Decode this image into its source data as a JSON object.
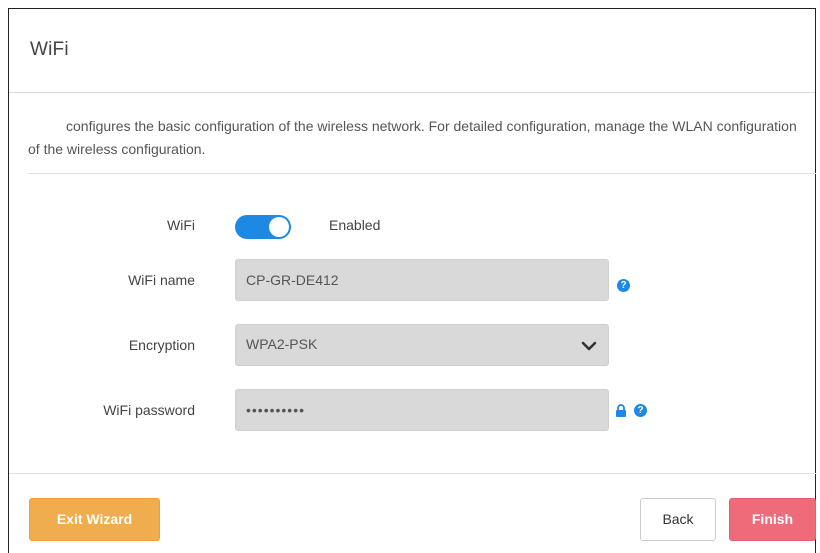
{
  "dialog": {
    "title": "WiFi",
    "description": "configures the basic configuration of the wireless network. For detailed configuration, manage the WLAN configuration of the wireless configuration."
  },
  "form": {
    "wifi": {
      "label": "WiFi",
      "state_text": "Enabled",
      "enabled": true
    },
    "wifi_name": {
      "label": "WiFi name",
      "value": "CP-GR-DE412"
    },
    "encryption": {
      "label": "Encryption",
      "selected": "WPA2-PSK"
    },
    "wifi_password": {
      "label": "WiFi password",
      "masked_value": "••••••••••"
    }
  },
  "buttons": {
    "exit_wizard": "Exit Wizard",
    "back": "Back",
    "finish": "Finish"
  },
  "icons": {
    "help": "?",
    "help_icon": "question-circle-icon",
    "lock_icon": "lock-icon",
    "chevron_icon": "chevron-down-icon"
  },
  "colors": {
    "toggle_on": "#1e88e5",
    "exit_button": "#f0ad4e",
    "finish_button": "#ef6b7a",
    "field_background": "#d9d9d9"
  }
}
